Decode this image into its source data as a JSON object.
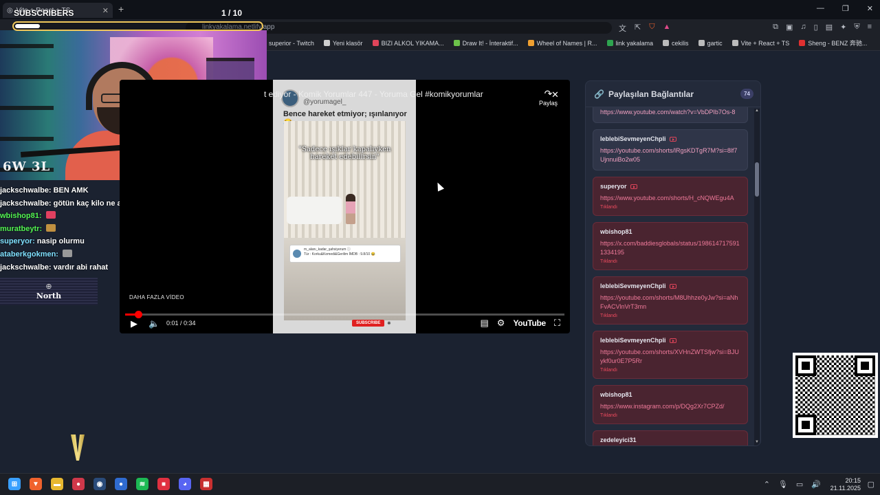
{
  "browser": {
    "tab_title": "Vite + React + TS",
    "page_counter": "1  / 10",
    "url": "linkyakalama.netlify.app",
    "bookmarks": [
      {
        "label": "superior - Twitch",
        "color": "#9146ff"
      },
      {
        "label": "Yeni klasör",
        "color": "#cfcfcf"
      },
      {
        "label": "BIZI ALKOL YIKAMA...",
        "color": "#e0455a"
      },
      {
        "label": "Draw It! - İnteraktif...",
        "color": "#6cc24a"
      },
      {
        "label": "Wheel of Names | R...",
        "color": "#f0a030"
      },
      {
        "label": "link yakalama",
        "color": "#2ea44f"
      },
      {
        "label": "cekilis",
        "color": "#bbbbbb"
      },
      {
        "label": "gartic",
        "color": "#bbbbbb"
      },
      {
        "label": "Vite + React + TS",
        "color": "#bbbbbb"
      },
      {
        "label": "Sheng - BENZ 奔驰...",
        "color": "#e03030"
      }
    ]
  },
  "stream_overlay": {
    "subscribers_label": "SUBSCRIBERS",
    "subscribers_progress": 0.1,
    "webcam_logo": "6W 3L",
    "north_label": "North"
  },
  "chat": [
    {
      "user": "jackschwalbe:",
      "user_color": "#ffffff",
      "text": "BEN AMK",
      "emote": ""
    },
    {
      "user": "jackschwalbe:",
      "user_color": "#ffffff",
      "text": "götün kaç kilo ne aq",
      "emote": ""
    },
    {
      "user": "wbishop81:",
      "user_color": "#53f553",
      "text": "",
      "emote": "#e04060"
    },
    {
      "user": "muratbeytr:",
      "user_color": "#53f553",
      "text": "",
      "emote": "#c09040"
    },
    {
      "user": "superyor:",
      "user_color": "#7fe0ff",
      "text": "nasip olurmu",
      "emote": ""
    },
    {
      "user": "ataberkgokmen:",
      "user_color": "#7fe0ff",
      "text": "",
      "emote": "#999999"
    },
    {
      "user": "jackschwalbe:",
      "user_color": "#ffffff",
      "text": "vardır abi rahat",
      "emote": ""
    }
  ],
  "video": {
    "title": "t ediyor - Komik Yorumlar 447 - Yoruma Gel #komikyorumlar",
    "channel_handle": "@yorumagel_",
    "caption": "Bence hareket etmiyor; ışınlanıyor 😂",
    "overlay_text": "\"Sadece ışıklar kapalıyken hareket edebilirsin\"",
    "card_line1": "m_alanı_kadar_şahsiyerum ⓘ",
    "card_line2": "Tür : Korku&Komedi&Gerilim İMDB : 9.8/10 😂",
    "share_label": "Paylaş",
    "more_videos_label": "DAHA FAZLA VİDEO",
    "subscribe_label": "SUBSCRIBE",
    "time": "0:01 / 0:34",
    "progress": 0.03,
    "logo_text": "YouTube"
  },
  "links_panel": {
    "title": "Paylaşılan Bağlantılar",
    "count": "74",
    "clicked_label": "Tıklandı",
    "items": [
      {
        "user": "",
        "url": "https://www.youtube.com/watch?v=VbDPIb7Os-8",
        "clicked": false,
        "yt": false
      },
      {
        "user": "leblebiSevmeyenChpli",
        "url": "https://youtube.com/shorts/lRgsKDTgR7M?si=8lf7UjnnuiBo2w05",
        "clicked": false,
        "yt": true
      },
      {
        "user": "superyor",
        "url": "https://www.youtube.com/shorts/H_cNQWEgu4A",
        "clicked": true,
        "yt": true
      },
      {
        "user": "wbishop81",
        "url": "https://x.com/baddiesglobals/status/1986147175911334195",
        "clicked": true,
        "yt": false
      },
      {
        "user": "leblebiSevmeyenChpli",
        "url": "https://youtube.com/shorts/M8Uhhze0yJw?si=aNhFvACVlnVrT3mn",
        "clicked": true,
        "yt": true
      },
      {
        "user": "leblebiSevmeyenChpli",
        "url": "https://youtube.com/shorts/XVHnZWTSfjw?si=BJUykf0ur0E7P5Rr",
        "clicked": true,
        "yt": true
      },
      {
        "user": "wbishop81",
        "url": "https://www.instagram.com/p/DQg2Xr7CPZd/",
        "clicked": true,
        "yt": false
      },
      {
        "user": "zedeleyici31",
        "url": "",
        "clicked": true,
        "yt": false
      }
    ]
  },
  "taskbar": {
    "time": "20:15",
    "date": "21.11.2025"
  }
}
